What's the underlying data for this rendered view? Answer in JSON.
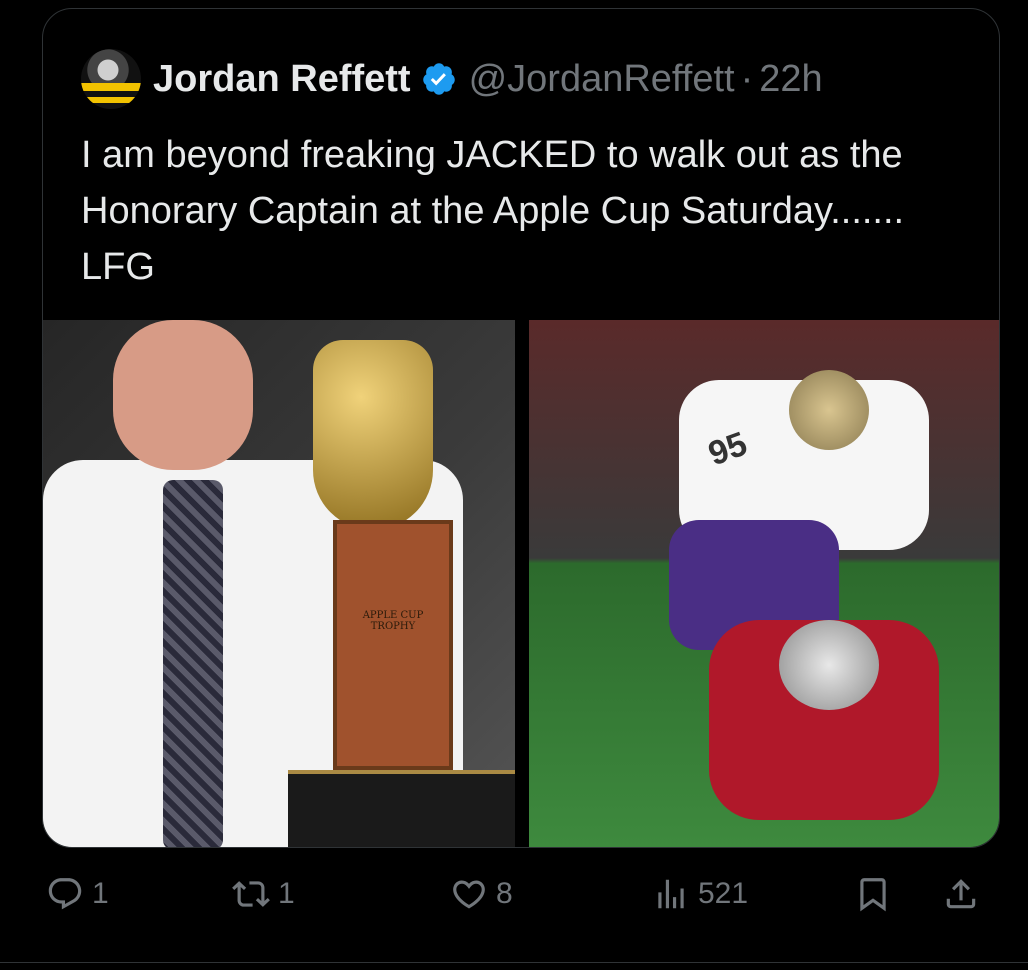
{
  "tweet": {
    "author": {
      "name": "Jordan Reffett",
      "handle": "@JordanReffett",
      "verified": true,
      "avatar_icon": "avatar-icon"
    },
    "dot": "·",
    "time": "22h",
    "text": "I am beyond freaking JACKED to walk out as the Honorary Captain at the Apple Cup Saturday....... LFG",
    "media": {
      "left_plaque": "APPLE CUP TROPHY",
      "right_jersey": "95"
    },
    "actions": {
      "reply_count": "1",
      "repost_count": "1",
      "like_count": "8",
      "views_count": "521"
    }
  },
  "colors": {
    "background": "#000000",
    "text": "#e7e9ea",
    "muted": "#71767b",
    "border": "#2f3336",
    "verified": "#1d9bf0"
  }
}
